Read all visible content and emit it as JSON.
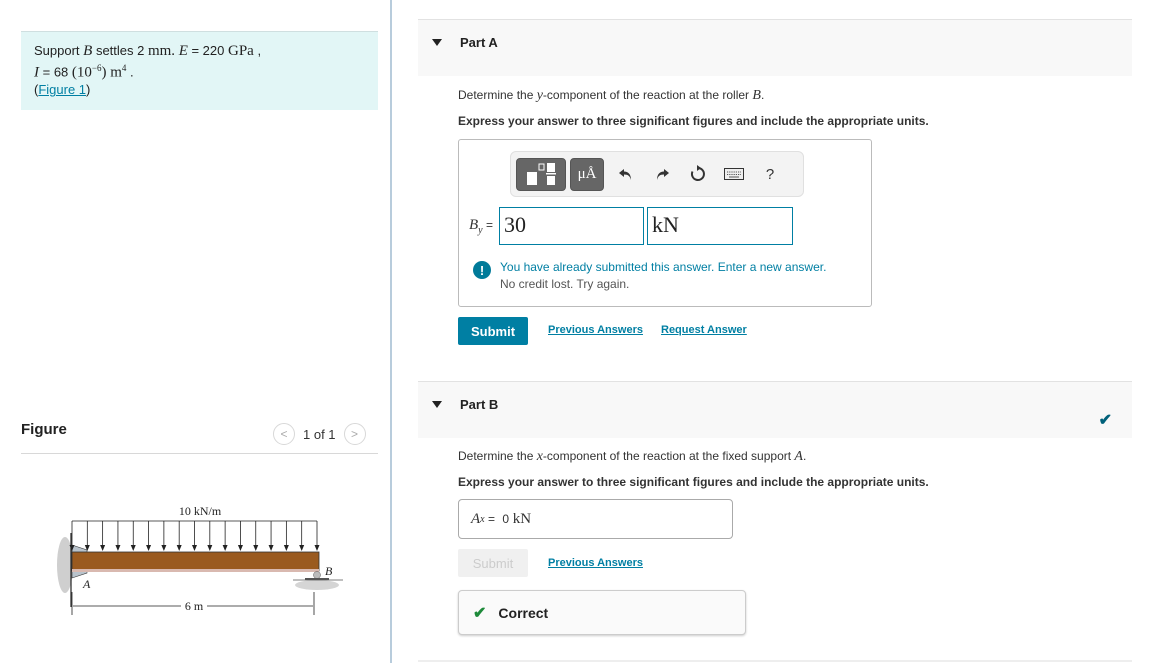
{
  "problem": {
    "line1_prefix": "Support ",
    "line1_var": "B",
    "line1_mid": " settles 2 ",
    "line1_unit": "mm.",
    "line1_E": "E",
    "line1_eq": " = 220 ",
    "line1_E_unit": "GPa",
    "line1_end": " ,",
    "line2_I": "I",
    "line2_eq": " = 68 ",
    "line2_paren": "(10",
    "line2_exp": "−6",
    "line2_close": ") m",
    "line2_exp2": "4",
    "line2_end": " .",
    "figure_link_open": "(",
    "figure_link": "Figure 1",
    "figure_link_close": ")"
  },
  "figure": {
    "title": "Figure",
    "pager": "1 of 1",
    "prev_icon": "chevron-left-icon",
    "next_icon": "chevron-right-icon",
    "load_label": "10 kN/m",
    "span_label": "6 m",
    "support_a": "A",
    "support_b": "B"
  },
  "part_a": {
    "title": "Part A",
    "question_prefix": "Determine the ",
    "question_var": "y",
    "question_mid": "-component of the reaction at the roller ",
    "question_point": "B",
    "question_end": ".",
    "instruction": "Express your answer to three significant figures and include the appropriate units.",
    "toolbar": {
      "template_icon": "fraction-template-icon",
      "units_label": "μÅ",
      "undo_icon": "undo-icon",
      "redo_icon": "redo-icon",
      "reset_icon": "reset-icon",
      "keyboard_icon": "keyboard-icon",
      "help_label": "?"
    },
    "eq_var": "B",
    "eq_sub": "y",
    "eq_sign": " =",
    "value": "30",
    "unit": "kN",
    "warning_main": "You have already submitted this answer. Enter a new answer.",
    "warning_sub": "No credit lost. Try again.",
    "submit": "Submit",
    "previous_answers": "Previous Answers",
    "request_answer": "Request Answer"
  },
  "part_b": {
    "title": "Part B",
    "question_prefix": "Determine the ",
    "question_var": "x",
    "question_mid": "-component of the reaction at the fixed support ",
    "question_point": "A",
    "question_end": ".",
    "instruction": "Express your answer to three significant figures and include the appropriate units.",
    "eq_var": "A",
    "eq_sub": "x",
    "eq_sign": " = ",
    "answer": "0",
    "answer_unit": " kN",
    "submit": "Submit",
    "previous_answers": "Previous Answers",
    "status": "Correct"
  }
}
